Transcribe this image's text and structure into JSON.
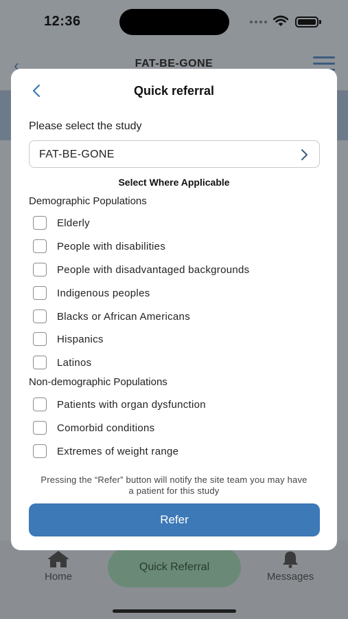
{
  "status_bar": {
    "time": "12:36"
  },
  "background_header": {
    "title": "FAT-BE-GONE"
  },
  "modal": {
    "title": "Quick referral",
    "study_label": "Please select the study",
    "study_value": "FAT-BE-GONE",
    "applicable_heading": "Select Where Applicable",
    "demographic_heading": "Demographic Populations",
    "demographic_items": [
      "Elderly",
      "People with disabilities",
      "People with disadvantaged backgrounds",
      "Indigenous peoples",
      "Blacks or African Americans",
      "Hispanics",
      "Latinos"
    ],
    "nondemographic_heading": "Non-demographic Populations",
    "nondemographic_items": [
      "Patients with organ dysfunction",
      "Comorbid conditions",
      "Extremes of weight range"
    ],
    "note": "Pressing the “Refer” button will notify the site team you may have a patient for this study",
    "refer_label": "Refer"
  },
  "tab_bar": {
    "home_label": "Home",
    "quick_label": "Quick Referral",
    "messages_label": "Messages"
  },
  "colors": {
    "accent": "#3d78b7",
    "quick_tab": "#6a8a77"
  }
}
